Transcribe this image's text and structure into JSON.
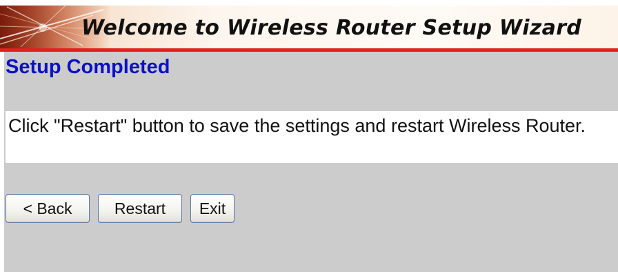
{
  "banner": {
    "title": "Welcome to Wireless Router Setup Wizard",
    "rule_color": "#e2211c"
  },
  "main": {
    "heading": "Setup Completed",
    "heading_color": "#0b10c8",
    "message": "Click \"Restart\" button to save the settings and restart Wireless Router."
  },
  "buttons": {
    "back_label": "< Back",
    "restart_label": "Restart",
    "exit_label": "Exit"
  },
  "colors": {
    "content_background": "#cccccc",
    "message_background": "#ffffff"
  }
}
